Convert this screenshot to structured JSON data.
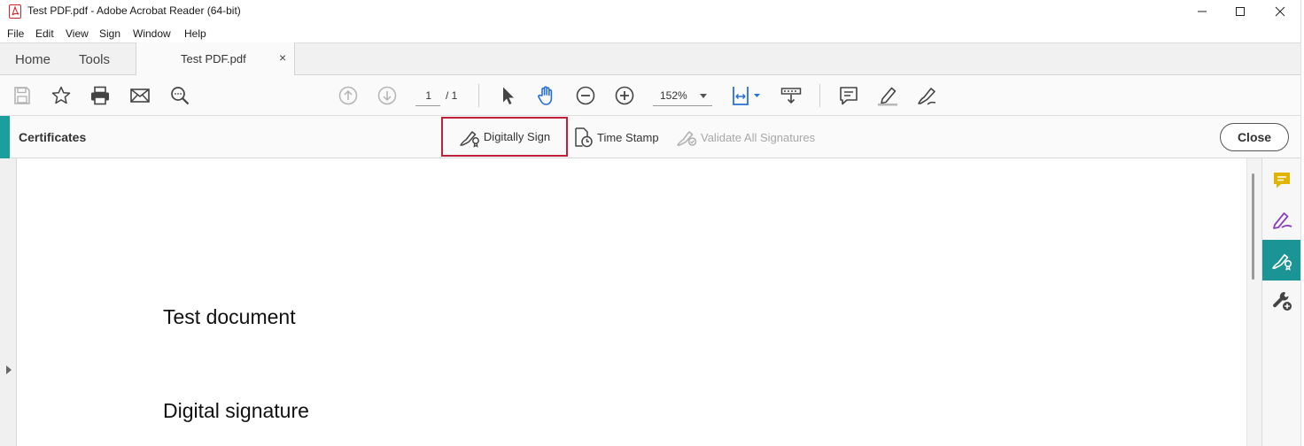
{
  "window": {
    "title": "Test PDF.pdf - Adobe Acrobat Reader (64-bit)"
  },
  "menu": [
    "File",
    "Edit",
    "View",
    "Sign",
    "Window",
    "Help"
  ],
  "tabs": {
    "home": "Home",
    "tools": "Tools",
    "document": "Test PDF.pdf",
    "close_glyph": "×"
  },
  "toolbar": {
    "current_page": "1",
    "page_total": "/ 1",
    "zoom": "152%"
  },
  "certificates_bar": {
    "title": "Certificates",
    "digitally_sign": "Digitally Sign",
    "time_stamp": "Time Stamp",
    "validate_all": "Validate All Signatures",
    "close": "Close"
  },
  "document": {
    "lines": [
      "Test document",
      "Digital signature"
    ]
  },
  "colors": {
    "accent_teal": "#1a9e9e",
    "highlight_red": "#c0203a",
    "hand_tool_blue": "#2670d9",
    "comment_yellow": "#e0b400",
    "fill_sign_purple": "#8a3fc0"
  },
  "icons": {
    "toolbar": [
      "save-icon",
      "bookmark-star-icon",
      "print-icon",
      "email-icon",
      "search-zoom-icon",
      "page-up-icon",
      "page-down-icon",
      "select-cursor-icon",
      "hand-tool-icon",
      "zoom-out-icon",
      "zoom-in-icon",
      "fit-page-icon",
      "scroll-mode-icon",
      "comment-icon",
      "highlight-pen-icon",
      "sign-pen-icon"
    ],
    "right_rail": [
      "comment-icon",
      "fill-sign-icon",
      "certificates-icon",
      "more-tools-icon"
    ]
  }
}
